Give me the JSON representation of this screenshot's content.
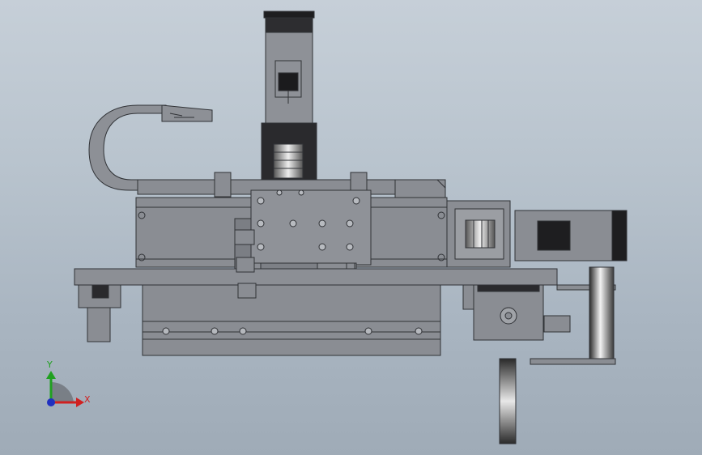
{
  "viewport": {
    "background_top": "#c6cfd8",
    "background_bottom": "#9fabb7"
  },
  "triad": {
    "y_label": "Y",
    "x_label": "X",
    "y_color": "#20a020",
    "x_color": "#d02020",
    "z_color": "#2030c0"
  },
  "model": {
    "body_color": "#8a8d93",
    "dark_color": "#2b2b2e",
    "edge_color": "#303236"
  }
}
